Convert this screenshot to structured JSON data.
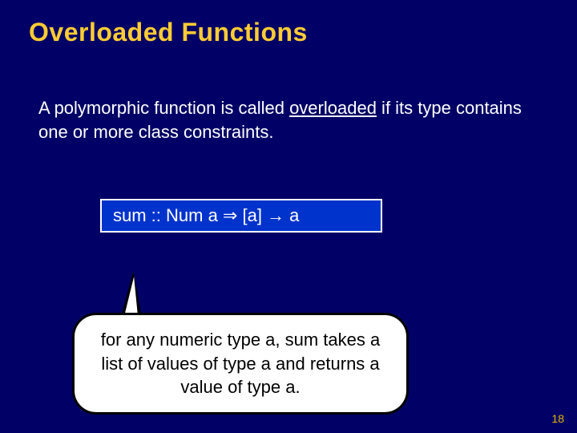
{
  "title": "Overloaded Functions",
  "body": {
    "pre": "A polymorphic function is called ",
    "overloaded": "overloaded",
    "post": " if its type contains one or more class constraints."
  },
  "code": {
    "p1": "sum :: Num a ",
    "arr1": "⇒",
    "p2": " [a] ",
    "arr2": "→",
    "p3": " a"
  },
  "callout": "for any numeric type a, sum takes a list of values of type a and returns a value of type a.",
  "page_number": "18"
}
